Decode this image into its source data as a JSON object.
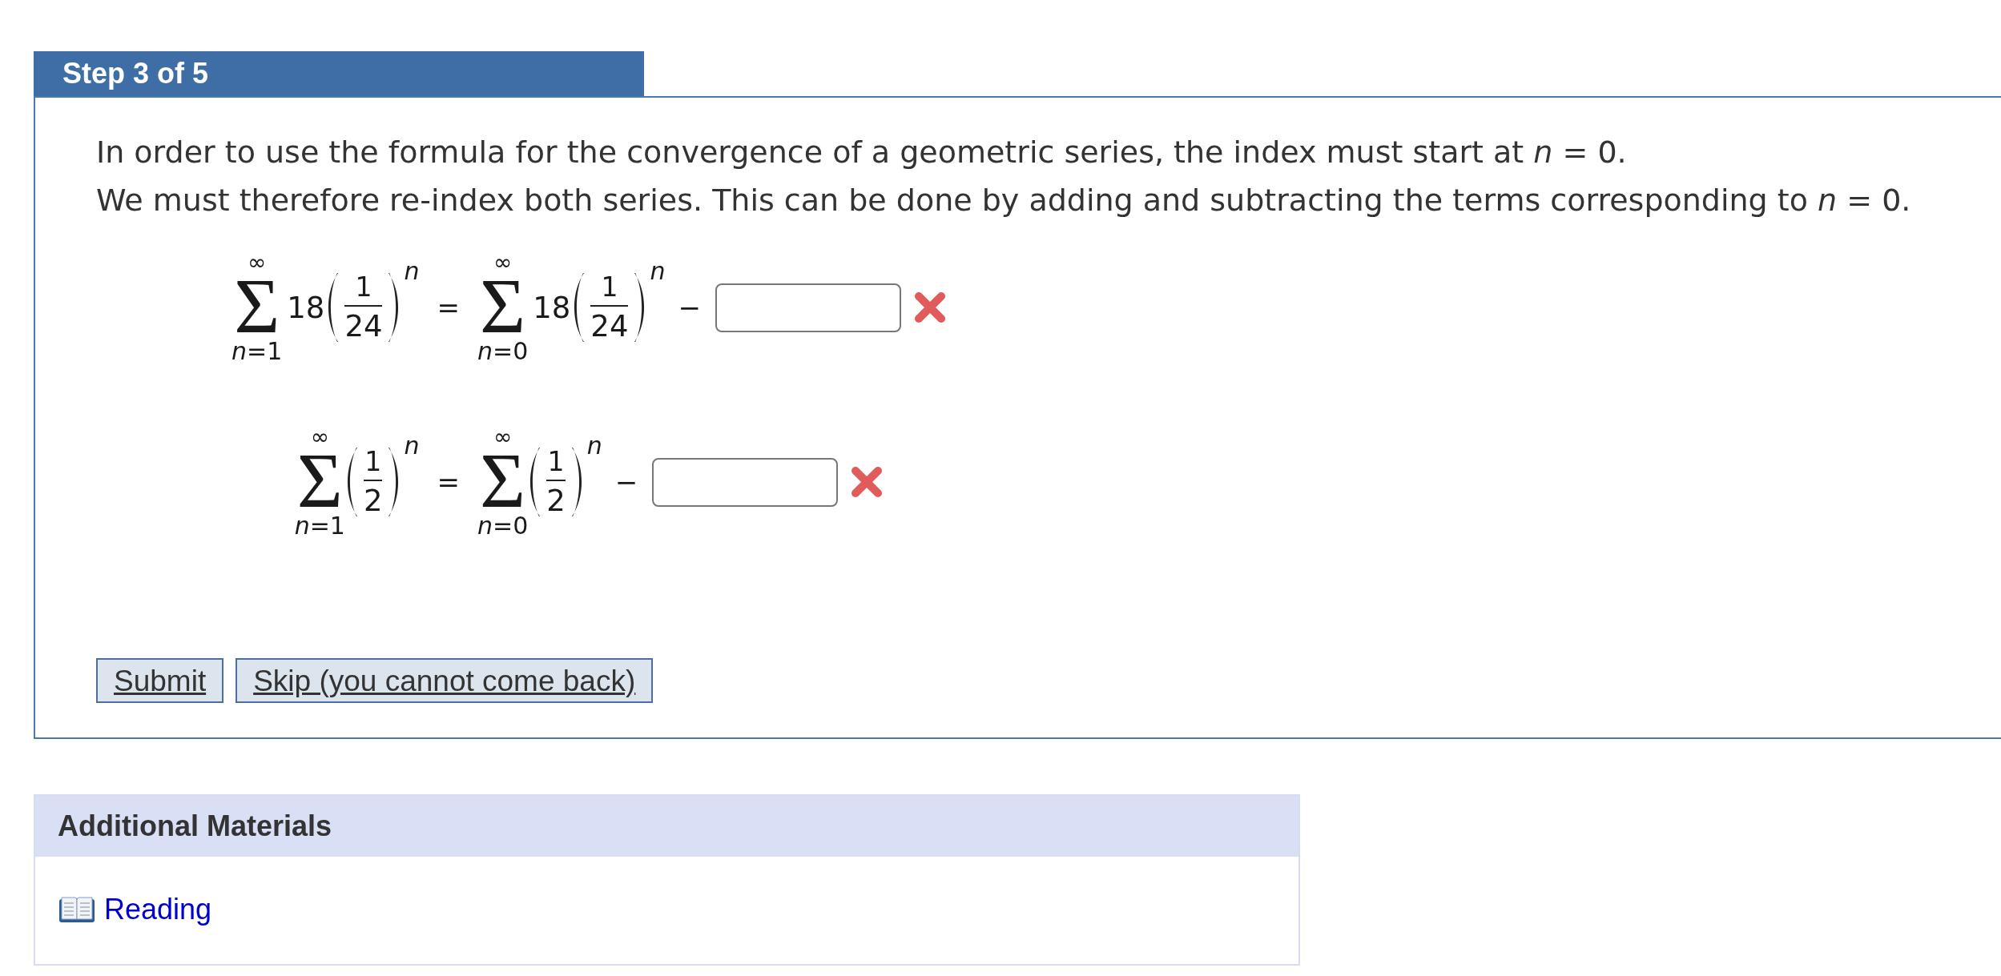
{
  "step_header": {
    "title": "Step 3 of 5"
  },
  "instructions": [
    "In order to use the formula for the convergence of a geometric series, the index must start at *n* = 0.",
    "We must therefore re-index both series. This can be done by adding and subtracting the terms corresponding to *n* = 0."
  ],
  "equations": [
    {
      "left": {
        "upper": "∞",
        "operator": "Σ",
        "lower": "*n*=1",
        "coefficient": "18",
        "numerator": "1",
        "denominator": "24",
        "exponent": "n"
      },
      "relation": "=",
      "right": {
        "upper": "∞",
        "operator": "Σ",
        "lower": "*n*=0",
        "coefficient": "18",
        "numerator": "1",
        "denominator": "24",
        "exponent": "n"
      },
      "operation": "−",
      "answer": {
        "incorrect": true
      }
    },
    {
      "left": {
        "upper": "∞",
        "operator": "Σ",
        "lower": "*n*=1",
        "numerator": "1",
        "denominator": "2",
        "exponent": "n"
      },
      "relation": "=",
      "right": {
        "upper": "∞",
        "operator": "Σ",
        "lower": "*n*=0",
        "numerator": "1",
        "denominator": "2",
        "exponent": "n"
      },
      "operation": "−",
      "answer": {
        "incorrect": true
      }
    }
  ],
  "buttons": [
    {
      "label": "Submit"
    },
    {
      "label": "Skip (you cannot come back)"
    }
  ],
  "additional_materials": {
    "title": "Additional Materials",
    "links": [
      {
        "label": "Reading"
      }
    ]
  }
}
